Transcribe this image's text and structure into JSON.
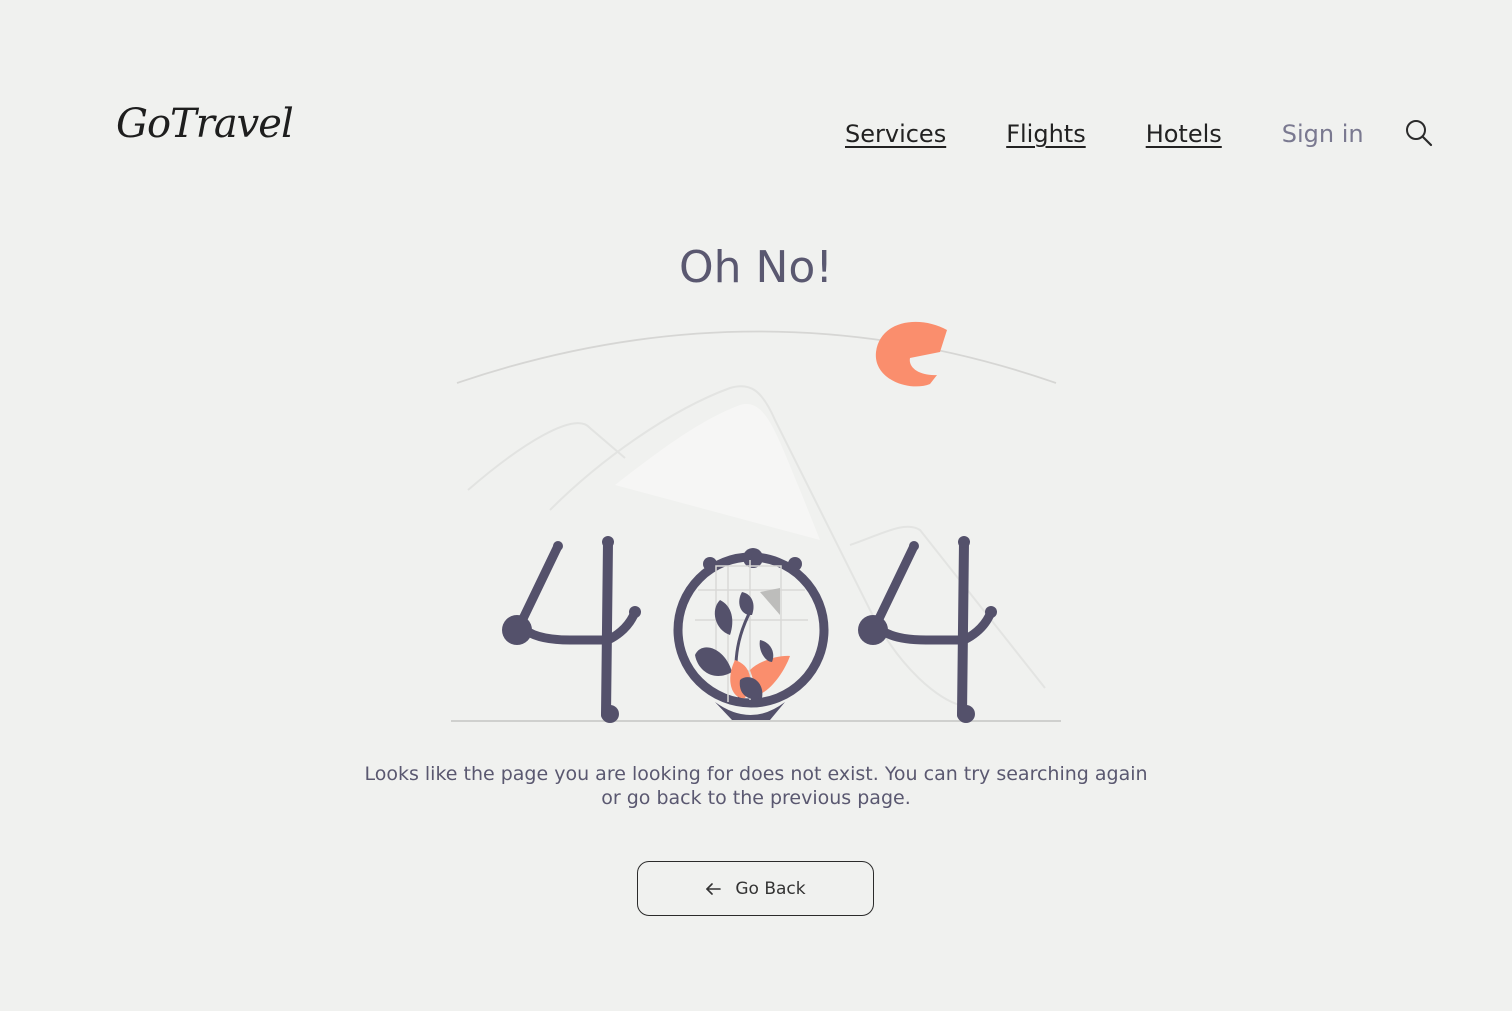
{
  "header": {
    "logo_text": "GoTravel",
    "nav": {
      "services": "Services",
      "flights": "Flights",
      "hotels": "Hotels",
      "signin": "Sign in"
    }
  },
  "main": {
    "title": "Oh No!",
    "message": "Looks like the page you are looking for does not exist. You can try searching again or go back to the previous page.",
    "go_back_label": "Go Back"
  },
  "colors": {
    "background": "#f0f1ef",
    "accent": "#fa8e6d",
    "ink": "#54516b"
  },
  "icons": [
    "search-icon",
    "arrow-left-icon",
    "404-illustration"
  ]
}
